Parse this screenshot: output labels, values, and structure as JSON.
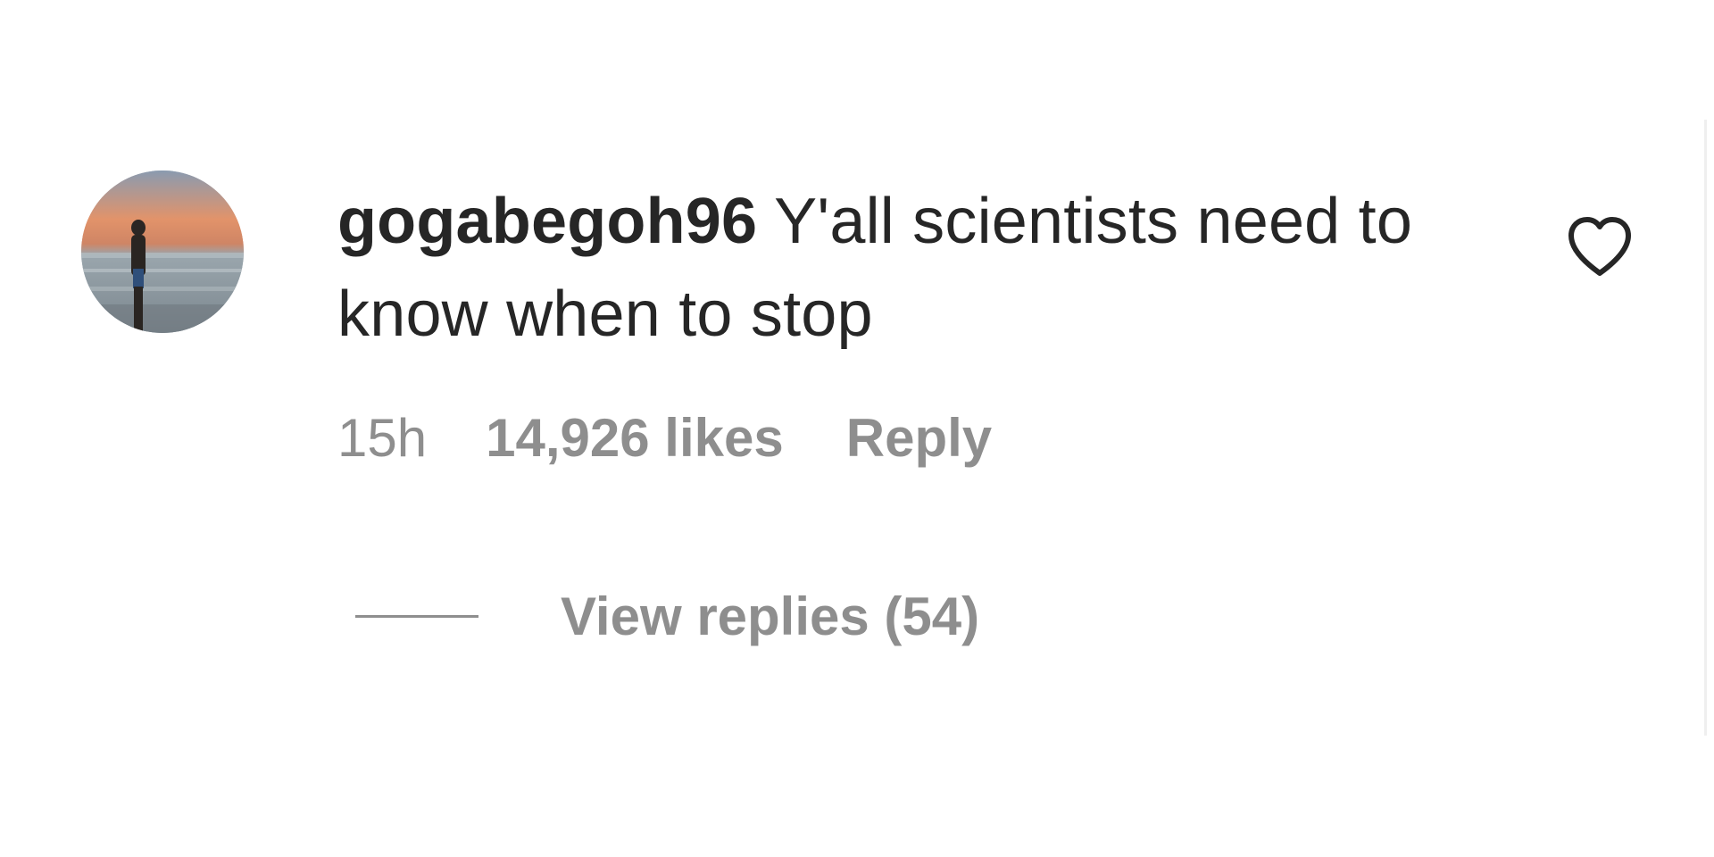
{
  "comment": {
    "username": "gogabegoh96",
    "text": "Y'all scientists need to know when to stop",
    "time": "15h",
    "likes": "14,926 likes",
    "reply_label": "Reply",
    "view_replies_label": "View replies (54)"
  },
  "icons": {
    "like": "heart-outline-icon"
  },
  "colors": {
    "primary_text": "#262626",
    "secondary_text": "#8e8e8e",
    "background": "#ffffff"
  }
}
